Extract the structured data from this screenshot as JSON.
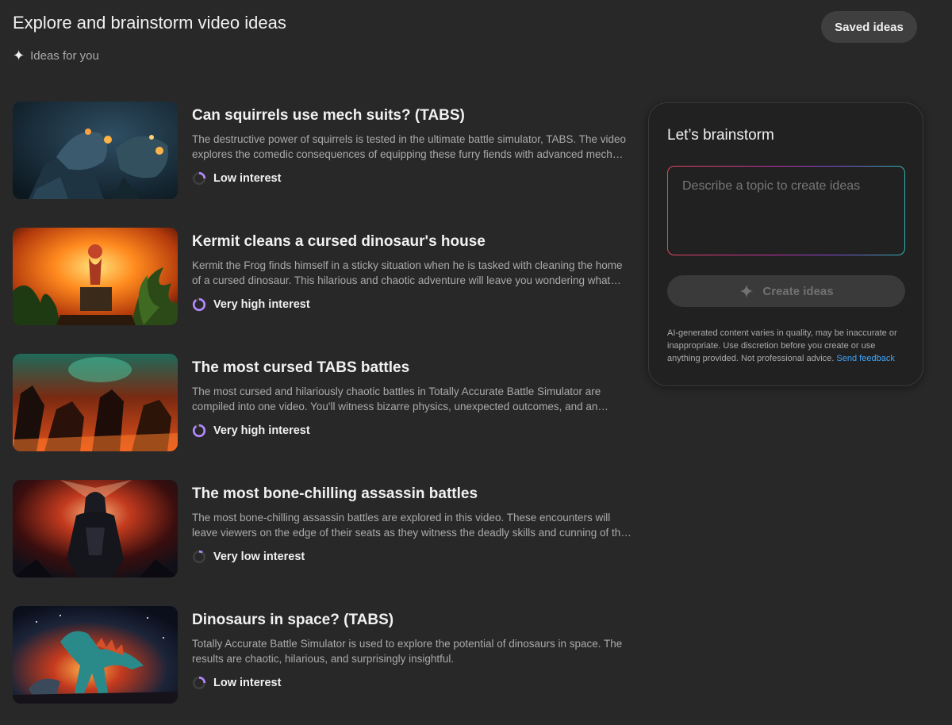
{
  "header": {
    "title": "Explore and brainstorm video ideas",
    "saved_label": "Saved ideas",
    "subtitle": "Ideas for you",
    "subtitle_icon": "sparkle-icon"
  },
  "ideas": [
    {
      "title": "Can squirrels use mech suits? (TABS)",
      "description": "The destructive power of squirrels is tested in the ultimate battle simulator, TABS. The video explores the comedic consequences of equipping these furry fiends with advanced mech suits.",
      "interest": "Low interest",
      "interest_level": 0.25,
      "thumbnail": "mech-squirrel-thumbnail"
    },
    {
      "title": "Kermit cleans a cursed dinosaur's house",
      "description": "Kermit the Frog finds himself in a sticky situation when he is tasked with cleaning the home of a cursed dinosaur. This hilarious and chaotic adventure will leave you wondering what happens next.",
      "interest": "Very high interest",
      "interest_level": 0.9,
      "thumbnail": "kermit-jungle-thumbnail"
    },
    {
      "title": "The most cursed TABS battles",
      "description": "The most cursed and hilariously chaotic battles in Totally Accurate Battle Simulator are compiled into one video. You'll witness bizarre physics, unexpected outcomes, and an assortment of strange units.",
      "interest": "Very high interest",
      "interest_level": 0.9,
      "thumbnail": "cursed-battle-thumbnail"
    },
    {
      "title": "The most bone-chilling assassin battles",
      "description": "The most bone-chilling assassin battles are explored in this video. These encounters will leave viewers on the edge of their seats as they witness the deadly skills and cunning of the assassins.",
      "interest": "Very low interest",
      "interest_level": 0.1,
      "thumbnail": "assassin-thumbnail"
    },
    {
      "title": "Dinosaurs in space? (TABS)",
      "description": "Totally Accurate Battle Simulator is used to explore the potential of dinosaurs in space. The results are chaotic, hilarious, and surprisingly insightful.",
      "interest": "Low interest",
      "interest_level": 0.25,
      "thumbnail": "space-dinosaur-thumbnail"
    }
  ],
  "brainstorm": {
    "title": "Let’s brainstorm",
    "placeholder": "Describe a topic to create ideas",
    "create_label": "Create ideas",
    "disclaimer": "AI-generated content varies in quality, may be inaccurate or inappropriate. Use discretion before you create or use anything provided. Not professional advice.",
    "feedback_label": "Send feedback"
  },
  "colors": {
    "background": "#282828",
    "panel": "#212121",
    "gauge_fill": "#b388ff",
    "gauge_track": "#3d3d3d",
    "link": "#3ea6ff"
  }
}
